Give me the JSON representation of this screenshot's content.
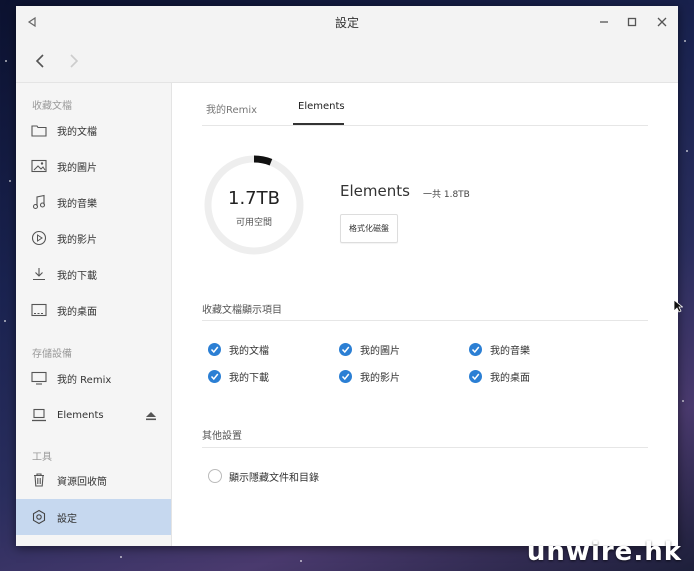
{
  "window": {
    "title": "設定"
  },
  "sidebar": {
    "sections": [
      {
        "label": "收藏文檔"
      },
      {
        "label": "存儲設備"
      },
      {
        "label": "工具"
      }
    ],
    "items": [
      {
        "label": "我的文檔",
        "icon": "folder-icon"
      },
      {
        "label": "我的圖片",
        "icon": "image-icon"
      },
      {
        "label": "我的音樂",
        "icon": "music-icon"
      },
      {
        "label": "我的影片",
        "icon": "video-icon"
      },
      {
        "label": "我的下載",
        "icon": "download-icon"
      },
      {
        "label": "我的桌面",
        "icon": "desktop-icon"
      },
      {
        "label": "我的 Remix",
        "icon": "monitor-icon"
      },
      {
        "label": "Elements",
        "icon": "drive-icon"
      },
      {
        "label": "資源回收筒",
        "icon": "trash-icon"
      },
      {
        "label": "設定",
        "icon": "settings-icon",
        "active": true
      }
    ]
  },
  "tabs": [
    {
      "label": "我的Remix",
      "active": false
    },
    {
      "label": "Elements",
      "active": true
    }
  ],
  "storage": {
    "available": "1.7TB",
    "available_label": "可用空間",
    "used_fraction": 0.06,
    "device_name": "Elements",
    "total": "一共 1.8TB",
    "format_button": "格式化磁盤"
  },
  "favorites_section": {
    "title": "收藏文檔顯示項目",
    "items": [
      {
        "label": "我的文檔",
        "checked": true
      },
      {
        "label": "我的圖片",
        "checked": true
      },
      {
        "label": "我的音樂",
        "checked": true
      },
      {
        "label": "我的下載",
        "checked": true
      },
      {
        "label": "我的影片",
        "checked": true
      },
      {
        "label": "我的桌面",
        "checked": true
      }
    ]
  },
  "other_section": {
    "title": "其他設置",
    "option": {
      "label": "顯示隱藏文件和目錄",
      "checked": false
    }
  },
  "watermark": "unwire.hk",
  "colors": {
    "accent": "#2b7fd4",
    "active_bg": "#c6d8ef"
  }
}
